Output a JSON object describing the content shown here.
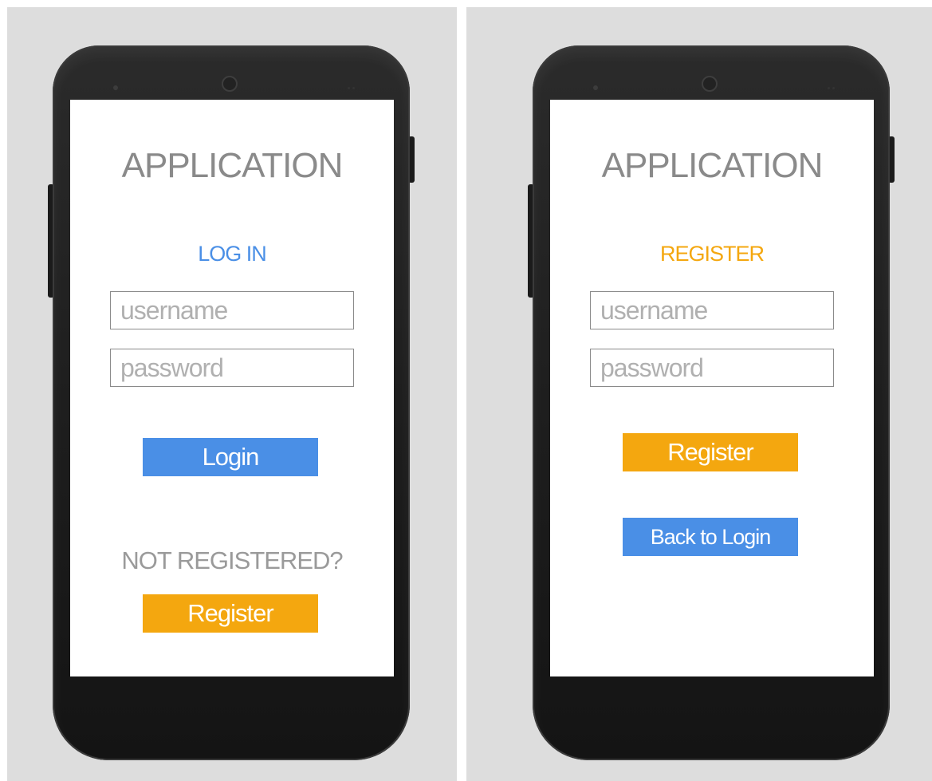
{
  "colors": {
    "background": "#dddddd",
    "accent_blue": "#4a8fe6",
    "accent_orange": "#f4a70f",
    "title_gray": "#8a8a8a"
  },
  "login_screen": {
    "app_title": "APPLICATION",
    "heading": "LOG IN",
    "username_placeholder": "username",
    "password_placeholder": "password",
    "login_button": "Login",
    "not_registered_text": "NOT REGISTERED?",
    "register_button": "Register"
  },
  "register_screen": {
    "app_title": "APPLICATION",
    "heading": "REGISTER",
    "username_placeholder": "username",
    "password_placeholder": "password",
    "register_button": "Register",
    "back_button": "Back to Login"
  }
}
